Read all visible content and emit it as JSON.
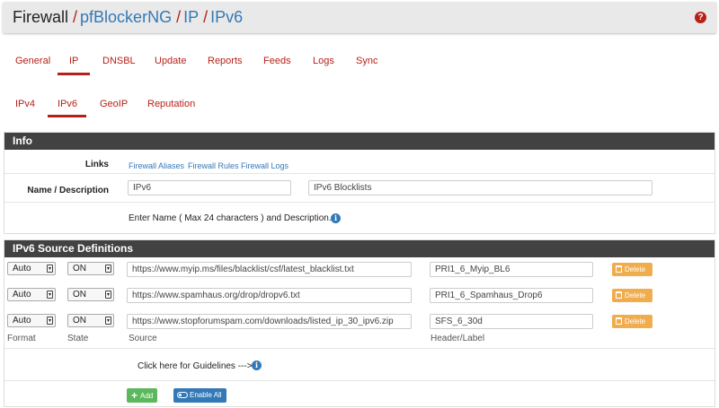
{
  "breadcrumb": [
    "Firewall",
    "pfBlockerNG",
    "IP",
    "IPv6"
  ],
  "breadcrumb_sep": "/",
  "help_icon": "question-circle-icon",
  "main_tabs": [
    "General",
    "IP",
    "DNSBL",
    "Update",
    "Reports",
    "Feeds",
    "Logs",
    "Sync"
  ],
  "main_active": "IP",
  "sub_tabs": [
    "IPv4",
    "IPv6",
    "GeoIP",
    "Reputation"
  ],
  "sub_active": "IPv6",
  "info_panel": {
    "title": "Info",
    "links_label": "Links",
    "links": [
      "Firewall Aliases",
      "Firewall Rules",
      "Firewall Logs"
    ],
    "name_label": "Name / Description",
    "name_value": "IPv6",
    "description_value": "IPv6 Blocklists",
    "note": "Enter Name ( Max 24 characters ) and Description."
  },
  "sources_panel": {
    "title": "IPv6 Source Definitions",
    "rows": [
      {
        "format": "Auto",
        "state": "ON",
        "source": "https://www.myip.ms/files/blacklist/csf/latest_blacklist.txt",
        "header": "PRI1_6_Myip_BL6"
      },
      {
        "format": "Auto",
        "state": "ON",
        "source": "https://www.spamhaus.org/drop/dropv6.txt",
        "header": "PRI1_6_Spamhaus_Drop6"
      },
      {
        "format": "Auto",
        "state": "ON",
        "source": "https://www.stopforumspam.com/downloads/listed_ip_30_ipv6.zip",
        "header": "SFS_6_30d"
      }
    ],
    "delete_label": "Delete",
    "col_labels": {
      "format": "Format",
      "state": "State",
      "source": "Source",
      "header": "Header/Label"
    },
    "guidelines": "Click here for Guidelines --->",
    "add_label": "Add",
    "enable_all_label": "Enable All"
  },
  "colors": {
    "accent": "#b72017",
    "link": "#3379b7",
    "panel_head": "#424242",
    "warning": "#f0ad4e",
    "success": "#5cb85c"
  }
}
